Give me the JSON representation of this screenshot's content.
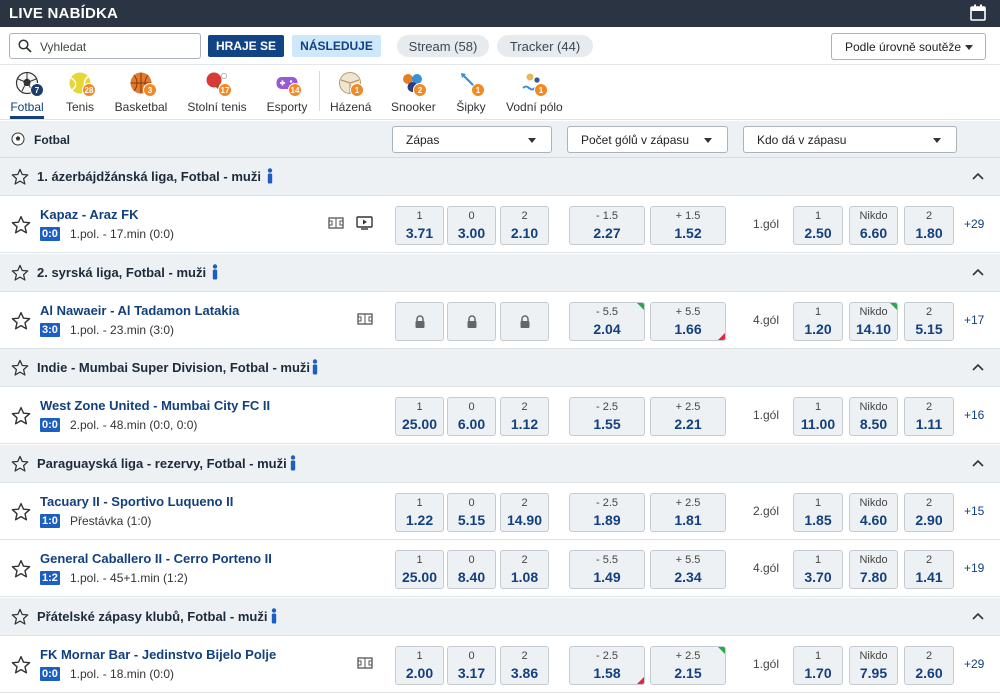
{
  "header": {
    "title": "LIVE NABÍDKA",
    "calendar_icon": "calendar-icon"
  },
  "filters": {
    "search_placeholder": "Vyhledat",
    "hraje_se": "HRAJE SE",
    "nasleduje": "NÁSLEDUJE",
    "stream": "Stream (58)",
    "tracker": "Tracker (44)",
    "sort": "Podle úrovně soutěže"
  },
  "sports": [
    {
      "label": "Fotbal",
      "count": "7",
      "icon": "football-icon",
      "active": true
    },
    {
      "label": "Tenis",
      "count": "28",
      "icon": "tennis-ball-icon"
    },
    {
      "label": "Basketbal",
      "count": "3",
      "icon": "basketball-icon"
    },
    {
      "label": "Stolní tenis",
      "count": "17",
      "icon": "table-tennis-icon"
    },
    {
      "label": "Esporty",
      "count": "14",
      "icon": "gamepad-icon"
    },
    {
      "label": "Házená",
      "count": "1",
      "icon": "handball-icon"
    },
    {
      "label": "Snooker",
      "count": "2",
      "icon": "snooker-icon"
    },
    {
      "label": "Šipky",
      "count": "1",
      "icon": "darts-icon"
    },
    {
      "label": "Vodní pólo",
      "count": "1",
      "icon": "water-polo-icon"
    }
  ],
  "column_header": {
    "sport": "Fotbal",
    "market1": "Zápas",
    "market2": "Počet gólů v zápasu",
    "market3": "Kdo dá v zápasu"
  },
  "leagues": [
    {
      "name": "1. ázerbájdžánská liga, Fotbal - muži",
      "matches": [
        {
          "name": "Kapaz - Araz FK",
          "score": "0:0",
          "status": "1.pol. - 17.min (0:0)",
          "stats": true,
          "tv": true,
          "m1": [
            [
              "1",
              "3.71"
            ],
            [
              "0",
              "3.00"
            ],
            [
              "2",
              "2.10"
            ]
          ],
          "m2": [
            [
              "- 1.5",
              "2.27"
            ],
            [
              "+ 1.5",
              "1.52"
            ]
          ],
          "goal": "1.gól",
          "m3": [
            [
              "1",
              "2.50"
            ],
            [
              "Nikdo",
              "6.60"
            ],
            [
              "2",
              "1.80"
            ]
          ],
          "more": "+29"
        }
      ]
    },
    {
      "name": "2. syrská liga, Fotbal - muži",
      "matches": [
        {
          "name": "Al Nawaeir - Al Tadamon Latakia",
          "score": "3:0",
          "status": "1.pol. - 23.min (3:0)",
          "stats": true,
          "tv": false,
          "locked": true,
          "m2": [
            [
              "- 5.5",
              "2.04"
            ],
            [
              "+ 5.5",
              "1.66"
            ]
          ],
          "m2_trend": [
            "up",
            "down"
          ],
          "goal": "4.gól",
          "m3": [
            [
              "1",
              "1.20"
            ],
            [
              "Nikdo",
              "14.10"
            ],
            [
              "2",
              "5.15"
            ]
          ],
          "m3_trend": [
            "",
            "up",
            ""
          ],
          "more": "+17"
        }
      ]
    },
    {
      "name": "Indie - Mumbai Super Division, Fotbal - muži",
      "matches": [
        {
          "name": "West Zone United - Mumbai City FC II",
          "score": "0:0",
          "status": "2.pol. - 48.min (0:0, 0:0)",
          "stats": false,
          "tv": false,
          "m1": [
            [
              "1",
              "25.00"
            ],
            [
              "0",
              "6.00"
            ],
            [
              "2",
              "1.12"
            ]
          ],
          "m2": [
            [
              "- 2.5",
              "1.55"
            ],
            [
              "+ 2.5",
              "2.21"
            ]
          ],
          "goal": "1.gól",
          "m3": [
            [
              "1",
              "11.00"
            ],
            [
              "Nikdo",
              "8.50"
            ],
            [
              "2",
              "1.11"
            ]
          ],
          "more": "+16"
        }
      ]
    },
    {
      "name": "Paraguayská liga - rezervy, Fotbal - muži",
      "matches": [
        {
          "name": "Tacuary II - Sportivo Luqueno II",
          "score": "1:0",
          "status": "Přestávka (1:0)",
          "stats": false,
          "tv": false,
          "m1": [
            [
              "1",
              "1.22"
            ],
            [
              "0",
              "5.15"
            ],
            [
              "2",
              "14.90"
            ]
          ],
          "m2": [
            [
              "- 2.5",
              "1.89"
            ],
            [
              "+ 2.5",
              "1.81"
            ]
          ],
          "goal": "2.gól",
          "m3": [
            [
              "1",
              "1.85"
            ],
            [
              "Nikdo",
              "4.60"
            ],
            [
              "2",
              "2.90"
            ]
          ],
          "more": "+15"
        },
        {
          "name": "General Caballero II - Cerro Porteno II",
          "score": "1:2",
          "status": "1.pol. - 45+1.min (1:2)",
          "stats": false,
          "tv": false,
          "m1": [
            [
              "1",
              "25.00"
            ],
            [
              "0",
              "8.40"
            ],
            [
              "2",
              "1.08"
            ]
          ],
          "m2": [
            [
              "- 5.5",
              "1.49"
            ],
            [
              "+ 5.5",
              "2.34"
            ]
          ],
          "goal": "4.gól",
          "m3": [
            [
              "1",
              "3.70"
            ],
            [
              "Nikdo",
              "7.80"
            ],
            [
              "2",
              "1.41"
            ]
          ],
          "more": "+19"
        }
      ]
    },
    {
      "name": "Přátelské zápasy klubů, Fotbal - muži",
      "matches": [
        {
          "name": "FK Mornar Bar - Jedinstvo Bijelo Polje",
          "score": "0:0",
          "status": "1.pol. - 18.min (0:0)",
          "stats": true,
          "tv": false,
          "m1": [
            [
              "1",
              "2.00"
            ],
            [
              "0",
              "3.17"
            ],
            [
              "2",
              "3.86"
            ]
          ],
          "m2": [
            [
              "- 2.5",
              "1.58"
            ],
            [
              "+ 2.5",
              "2.15"
            ]
          ],
          "m2_trend": [
            "down",
            "up"
          ],
          "goal": "1.gól",
          "m3": [
            [
              "1",
              "1.70"
            ],
            [
              "Nikdo",
              "7.95"
            ],
            [
              "2",
              "2.60"
            ]
          ],
          "more": "+29"
        }
      ]
    }
  ],
  "colors": {
    "brand": "#124384",
    "score_bg": "#1c5fc2",
    "odd_text": "#12407f",
    "badge": "#f08a24",
    "trend_up": "#2aa84a",
    "trend_down": "#e2283a"
  }
}
